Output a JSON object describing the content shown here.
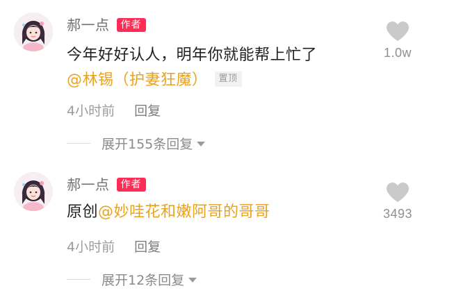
{
  "comments": [
    {
      "username": "郝一点",
      "badge": "作者",
      "text": "今年好好认人，明年你就能帮上忙了",
      "mention": "@林锡（护妻狂魔）",
      "pinned": "置顶",
      "time": "4小时前",
      "reply_label": "回复",
      "expand_label": "展开155条回复",
      "likes": "1.0w",
      "avatar_icon": "avatar-girl-icon",
      "heart_icon": "heart-icon"
    },
    {
      "username": "郝一点",
      "badge": "作者",
      "text_prefix": "原创",
      "mention": "@妙哇花和嫩阿哥的哥哥",
      "time": "4小时前",
      "reply_label": "回复",
      "expand_label": "展开12条回复",
      "likes": "3493",
      "avatar_icon": "avatar-girl-icon",
      "heart_icon": "heart-icon"
    }
  ],
  "colors": {
    "badge": "#ff2d55",
    "mention": "#e9a21e",
    "muted_text": "#9b9b9b",
    "heart": "#c7c7c7"
  }
}
